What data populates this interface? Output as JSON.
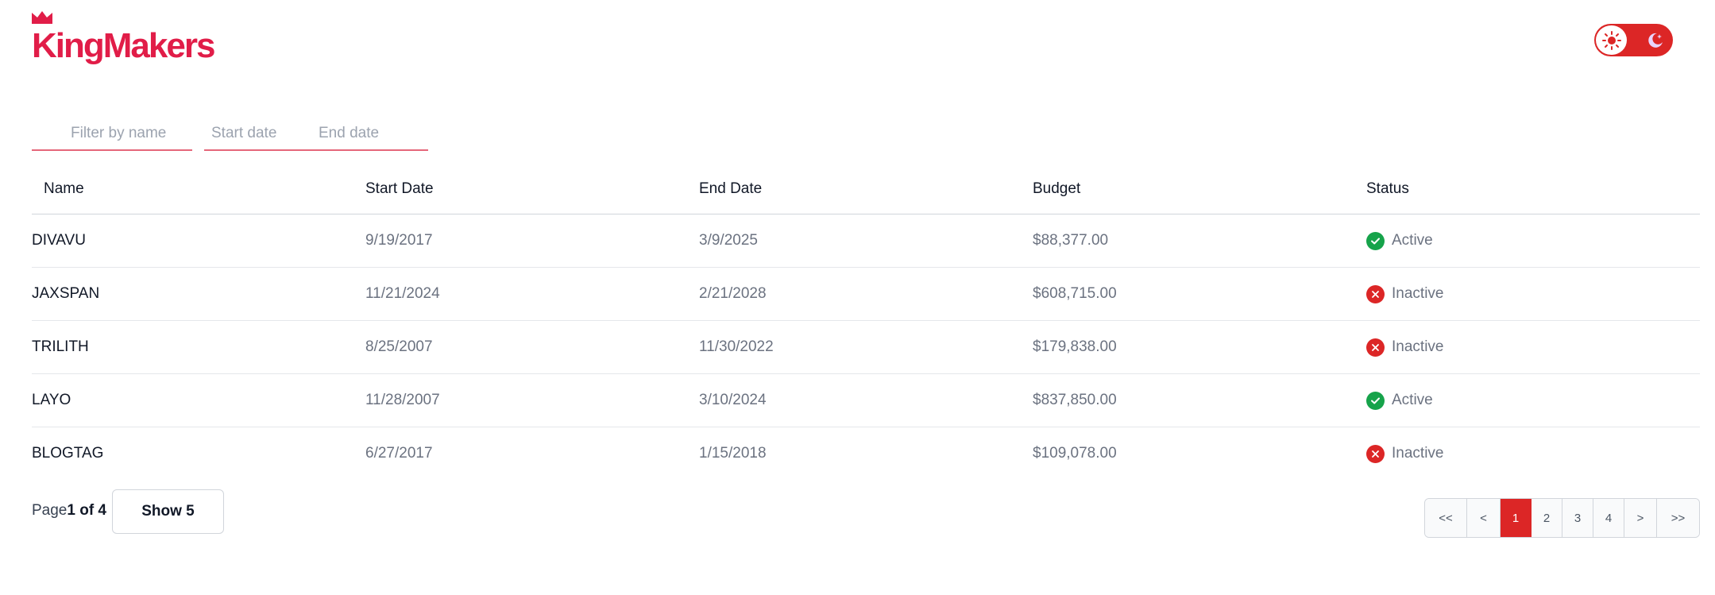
{
  "brand": {
    "name": "KingMakers",
    "color": "#e11d48"
  },
  "theme_toggle": {
    "light_icon": "sun-icon",
    "dark_icon": "moon-icon",
    "color": "#dc2626"
  },
  "filters": {
    "name_placeholder": "Filter by name",
    "start_placeholder": "Start date",
    "end_placeholder": "End date"
  },
  "table": {
    "headers": {
      "name": "Name",
      "start": "Start Date",
      "end": "End Date",
      "budget": "Budget",
      "status": "Status"
    },
    "rows": [
      {
        "name": "DIVAVU",
        "start": "9/19/2017",
        "end": "3/9/2025",
        "budget": "$88,377.00",
        "status": "Active",
        "status_icon": "check-circle-icon"
      },
      {
        "name": "JAXSPAN",
        "start": "11/21/2024",
        "end": "2/21/2028",
        "budget": "$608,715.00",
        "status": "Inactive",
        "status_icon": "x-circle-icon"
      },
      {
        "name": "TRILITH",
        "start": "8/25/2007",
        "end": "11/30/2022",
        "budget": "$179,838.00",
        "status": "Inactive",
        "status_icon": "x-circle-icon"
      },
      {
        "name": "LAYO",
        "start": "11/28/2007",
        "end": "3/10/2024",
        "budget": "$837,850.00",
        "status": "Active",
        "status_icon": "check-circle-icon"
      },
      {
        "name": "BLOGTAG",
        "start": "6/27/2017",
        "end": "1/15/2018",
        "budget": "$109,078.00",
        "status": "Inactive",
        "status_icon": "x-circle-icon"
      }
    ],
    "status_colors": {
      "active": "#16a34a",
      "inactive": "#dc2626"
    }
  },
  "footer": {
    "page_prefix": "Page",
    "page_current": "1 of 4",
    "show_label": "Show 5",
    "pager": {
      "first": "<<",
      "prev": "<",
      "pages": [
        "1",
        "2",
        "3",
        "4"
      ],
      "current": "1",
      "next": ">",
      "last": ">>"
    }
  }
}
